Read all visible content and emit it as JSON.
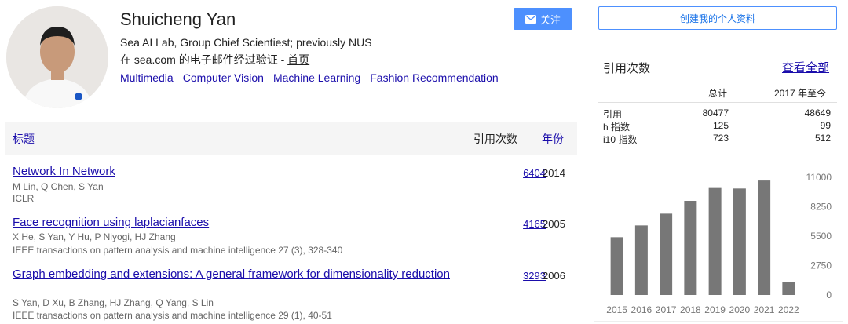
{
  "profile": {
    "name": "Shuicheng Yan",
    "affiliation": "Sea AI Lab, Group Chief Scientiest; previously NUS",
    "verify_prefix": "在 sea.com 的电子邮件经过验证 - ",
    "verify_link": "首页",
    "interests": [
      "Multimedia",
      "Computer Vision",
      "Machine Learning",
      "Fashion Recommendation"
    ]
  },
  "follow_label": "关注",
  "create_profile_label": "创建我的个人资料",
  "table": {
    "col_title": "标题",
    "col_cited": "引用次数",
    "col_year": "年份",
    "rows": [
      {
        "title": "Network In Network",
        "authors": "M Lin, Q Chen, S Yan",
        "venue": "ICLR",
        "cited": "6404",
        "year": "2014"
      },
      {
        "title": "Face recognition using laplacianfaces",
        "authors": "X He, S Yan, Y Hu, P Niyogi, HJ Zhang",
        "venue": "IEEE transactions on pattern analysis and machine intelligence 27 (3), 328-340",
        "cited": "4165",
        "year": "2005"
      },
      {
        "title": "Graph embedding and extensions: A general framework for dimensionality reduction",
        "authors": "S Yan, D Xu, B Zhang, HJ Zhang, Q Yang, S Lin",
        "venue": "IEEE transactions on pattern analysis and machine intelligence 29 (1), 40-51",
        "cited": "3293",
        "year": "2006"
      }
    ]
  },
  "stats": {
    "heading": "引用次数",
    "view_all": "查看全部",
    "col_total": "总计",
    "col_since": "2017 年至今",
    "rows": [
      {
        "label": "引用",
        "total": "80477",
        "since": "48649"
      },
      {
        "label": "h 指数",
        "total": "125",
        "since": "99"
      },
      {
        "label": "i10 指数",
        "total": "723",
        "since": "512"
      }
    ]
  },
  "chart_data": {
    "type": "bar",
    "categories": [
      "2015",
      "2016",
      "2017",
      "2018",
      "2019",
      "2020",
      "2021",
      "2022"
    ],
    "values": [
      5400,
      6500,
      7600,
      8800,
      10000,
      9950,
      10700,
      1200
    ],
    "yticks": [
      0,
      2750,
      5500,
      8250,
      11000
    ],
    "ylim": [
      0,
      11000
    ],
    "bar_color": "#777777"
  },
  "colors": {
    "link": "#1a0dab",
    "button": "#4d90fe"
  }
}
